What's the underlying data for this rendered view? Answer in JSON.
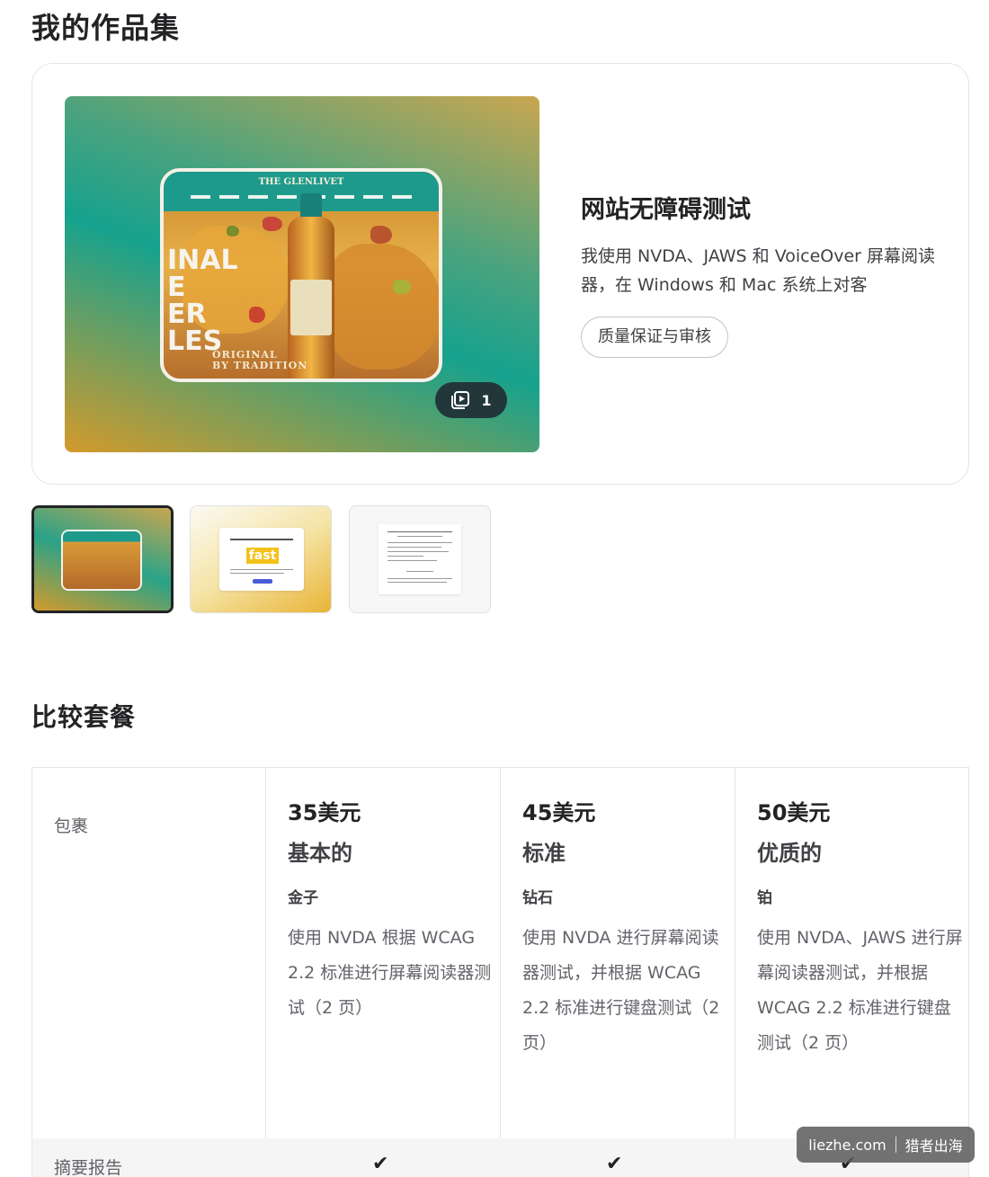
{
  "portfolio": {
    "heading": "我的作品集",
    "project_title": "网站无障碍测试",
    "project_description": "我使用 NVDA、JAWS 和 VoiceOver 屏幕阅读器，在 Windows 和 Mac 系统上对客",
    "project_tag": "质量保证与审核",
    "gallery_count": "1",
    "hero_screen": {
      "logo": "THE GLENLIVET",
      "big_text": "INAL\nE\nER\nLES",
      "small_text": "ORIGINAL\nBY TRADITION"
    },
    "thumbnail_2_text": "fast"
  },
  "compare": {
    "heading": "比较套餐",
    "row_label_package": "包裹",
    "row_label_summary": "摘要报告",
    "packages": [
      {
        "price": "35美元",
        "name": "基本的",
        "tier": "金子",
        "description": "使用 NVDA 根据 WCAG 2.2 标准进行屏幕阅读器测试（2 页）",
        "summary_check": "✔"
      },
      {
        "price": "45美元",
        "name": "标准",
        "tier": "钻石",
        "description": "使用 NVDA 进行屏幕阅读器测试，并根据 WCAG 2.2 标准进行键盘测试（2 页）",
        "summary_check": "✔"
      },
      {
        "price": "50美元",
        "name": "优质的",
        "tier": "铂",
        "description": "使用 NVDA、JAWS 进行屏幕阅读器测试，并根据 WCAG 2.2 标准进行键盘测试（2 页）",
        "summary_check": "✔"
      }
    ]
  },
  "watermark": {
    "site": "liezhe.com",
    "brand": "猎者出海"
  },
  "colors": {
    "text_primary": "#222325",
    "text_secondary": "#62646a",
    "border": "#e4e5e7",
    "badge_bg": "#22373a"
  }
}
